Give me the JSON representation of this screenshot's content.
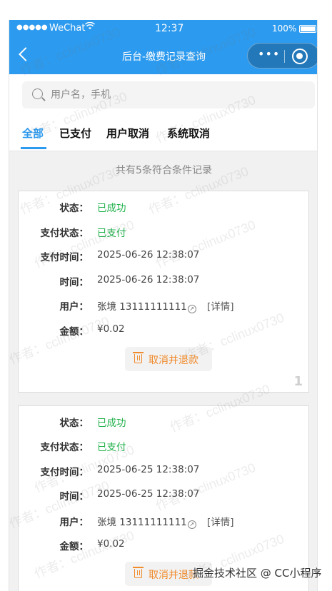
{
  "status_bar": {
    "signal": "●●●●●",
    "carrier": "WeChat",
    "wifi_icon": "wifi-icon",
    "time": "12:37",
    "battery": "100%"
  },
  "nav": {
    "title": "后台-缴费记录查询",
    "more_icon": "•••",
    "back_icon": "chevron-left-icon"
  },
  "search": {
    "placeholder": "用户名，手机"
  },
  "tabs": [
    {
      "label": "全部",
      "active": true
    },
    {
      "label": "已支付",
      "active": false
    },
    {
      "label": "用户取消",
      "active": false
    },
    {
      "label": "系统取消",
      "active": false
    }
  ],
  "summary": "共有5条符合条件记录",
  "labels": {
    "status": "状态：",
    "pay_status": "支付状态：",
    "pay_time": "支付时间：",
    "time": "时间：",
    "user": "用户：",
    "amount": "金额："
  },
  "records": [
    {
      "status": "已成功",
      "pay_status": "已支付",
      "pay_time": "2025-06-26 12:38:07",
      "time": "2025-06-26 12:38:07",
      "user": "张境 13111111111",
      "detail": "[详情]",
      "amount": "¥0.02",
      "action": "取消并退款",
      "index": "1"
    },
    {
      "status": "已成功",
      "pay_status": "已支付",
      "pay_time": "2025-06-25 12:38:07",
      "time": "2025-06-25 12:38:07",
      "user": "张境 13111111111",
      "detail": "[详情]",
      "amount": "¥0.02",
      "action": "取消并退款",
      "index": ""
    }
  ],
  "watermark": "作者：cclinux0730",
  "footer": "掘金技术社区 @ CC小程序",
  "colors": {
    "primary": "#2c9aee",
    "success": "#21b14b",
    "warning": "#f08a2a"
  }
}
